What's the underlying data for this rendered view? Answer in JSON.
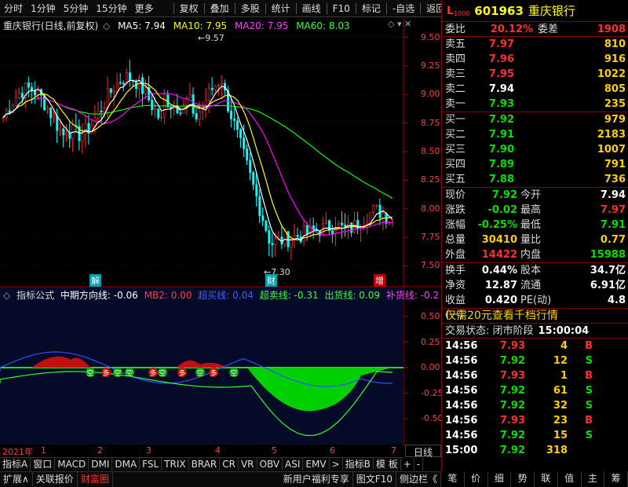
{
  "toolbar": {
    "items": [
      "分时",
      "1分钟",
      "5分钟",
      "15分钟",
      "更多",
      "复权",
      "叠加",
      "多股",
      "统计",
      "画线",
      "F10",
      "标记",
      "-自选",
      "返回"
    ]
  },
  "chart": {
    "title": "重庆银行(日线,前复权)",
    "ma5": "MA5: 7.94",
    "ma10": "MA10: 7.95",
    "ma20": "MA20: 7.95",
    "ma60": "MA60: 8.03",
    "high_tag": "9.57",
    "low_tag": "7.30",
    "y_ticks": [
      "9.50",
      "9.25",
      "9.00",
      "8.75",
      "8.50",
      "8.25",
      "8.00",
      "7.75",
      "7.50"
    ],
    "markers": [
      "解",
      "财",
      "增"
    ],
    "colors": {
      "ma5": "#ffffff",
      "ma10": "#ffff00",
      "ma20": "#ff00ff",
      "ma60": "#00ff00",
      "up": "#ff3030",
      "down": "#00ffff"
    }
  },
  "indicator": {
    "name": "指标公式",
    "mid": "中期方向线: -0.06",
    "mb2": "MB2: 0.00",
    "overbuy": "超买线: 0.04",
    "oversell": "超卖线: -0.31",
    "ship": "出货线: 0.09",
    "replenish": "补货线: -0.2",
    "y_ticks": [
      "0.50",
      "0.25",
      "0.00",
      "-0.25",
      "-0.50"
    ],
    "signal_labels": [
      "空",
      "多",
      "空",
      "空",
      "多",
      "空",
      "多",
      "空",
      "多",
      "空"
    ]
  },
  "timebar": {
    "year": "2021年",
    "months": [
      "1",
      "2",
      "3",
      "4",
      "5",
      "6",
      "7"
    ],
    "right": "日线"
  },
  "tabs": [
    "指标A",
    "窗口",
    "MACD",
    "DMI",
    "DMA",
    "FSL",
    "TRIX",
    "BRAR",
    "CR",
    "VR",
    "OBV",
    "ASI",
    "EMV",
    ">",
    "指标B",
    "模 板",
    "+",
    "-"
  ],
  "bottom": [
    "扩展∧",
    "关联报价",
    "财富圈",
    "新用户福利专享",
    "图文F10",
    "侧边栏《"
  ],
  "rightTabs": [
    "笔",
    "价",
    "细",
    "势",
    "联",
    "值",
    "主",
    "筹"
  ],
  "quote": {
    "code": "601963",
    "name": "重庆银行",
    "badge": "L",
    "webi_label": "委比",
    "webi": "20.12%",
    "wecha_label": "委差",
    "wecha": "1908",
    "asks": [
      {
        "l": "卖五",
        "p": "7.97",
        "v": "810",
        "c": "red"
      },
      {
        "l": "卖四",
        "p": "7.96",
        "v": "916",
        "c": "red"
      },
      {
        "l": "卖三",
        "p": "7.95",
        "v": "1022",
        "c": "red"
      },
      {
        "l": "卖二",
        "p": "7.94",
        "v": "805",
        "c": "white"
      },
      {
        "l": "卖一",
        "p": "7.93",
        "v": "235",
        "c": "green"
      }
    ],
    "bids": [
      {
        "l": "买一",
        "p": "7.92",
        "v": "979",
        "c": "green"
      },
      {
        "l": "买二",
        "p": "7.91",
        "v": "2183",
        "c": "green"
      },
      {
        "l": "买三",
        "p": "7.90",
        "v": "1007",
        "c": "green"
      },
      {
        "l": "买四",
        "p": "7.89",
        "v": "791",
        "c": "green"
      },
      {
        "l": "买五",
        "p": "7.88",
        "v": "736",
        "c": "green"
      }
    ],
    "stats": [
      {
        "l1": "现价",
        "v1": "7.92",
        "c1": "green",
        "l2": "今开",
        "v2": "7.94",
        "c2": "white"
      },
      {
        "l1": "涨跌",
        "v1": "-0.02",
        "c1": "green",
        "l2": "最高",
        "v2": "7.97",
        "c2": "red"
      },
      {
        "l1": "涨幅",
        "v1": "-0.25%",
        "c1": "green",
        "l2": "最低",
        "v2": "7.91",
        "c2": "green"
      },
      {
        "l1": "总量",
        "v1": "30410",
        "c1": "yellow",
        "l2": "量比",
        "v2": "0.77",
        "c2": "yellow"
      },
      {
        "l1": "外盘",
        "v1": "14422",
        "c1": "red",
        "l2": "内盘",
        "v2": "15988",
        "c2": "green"
      }
    ],
    "stats2": [
      {
        "l1": "换手",
        "v1": "0.44%",
        "c1": "white",
        "l2": "股本",
        "v2": "34.7亿",
        "c2": "white"
      },
      {
        "l1": "净资",
        "v1": "12.87",
        "c1": "white",
        "l2": "流通",
        "v2": "6.91亿",
        "c2": "white"
      },
      {
        "l1": "收益(一)",
        "v1": "0.420",
        "c1": "white",
        "l2": "PE(动)",
        "v2": "4.8",
        "c2": "white"
      }
    ],
    "promo": "仅需20元查看千档行情",
    "status_label": "交易状态: 闭市阶段",
    "status_time": "15:00:04",
    "ticks": [
      {
        "t": "14:56",
        "p": "7.93",
        "pc": "red",
        "v": "4",
        "d": "B",
        "dc": "red"
      },
      {
        "t": "14:56",
        "p": "7.92",
        "pc": "green",
        "v": "12",
        "d": "S",
        "dc": "green"
      },
      {
        "t": "14:56",
        "p": "7.93",
        "pc": "red",
        "v": "1",
        "d": "B",
        "dc": "red"
      },
      {
        "t": "14:56",
        "p": "7.92",
        "pc": "green",
        "v": "61",
        "d": "S",
        "dc": "green"
      },
      {
        "t": "14:56",
        "p": "7.92",
        "pc": "green",
        "v": "32",
        "d": "S",
        "dc": "green"
      },
      {
        "t": "14:56",
        "p": "7.93",
        "pc": "red",
        "v": "23",
        "d": "B",
        "dc": "red"
      },
      {
        "t": "14:56",
        "p": "7.92",
        "pc": "green",
        "v": "15",
        "d": "S",
        "dc": "green"
      },
      {
        "t": "15:00",
        "p": "7.92",
        "pc": "green",
        "v": "318",
        "d": "",
        "dc": "white"
      }
    ]
  }
}
